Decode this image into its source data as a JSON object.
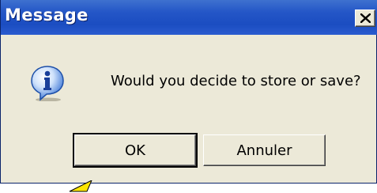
{
  "dialog": {
    "title": "Message",
    "close_label": "X",
    "icon": "info-icon",
    "message": "Would you decide to store or save?",
    "ok_label": "OK",
    "cancel_label": "Annuler"
  },
  "colors": {
    "titlebar": "#2456c7",
    "dialog_bg": "#ece9d8",
    "pointer": "#ffe600"
  }
}
